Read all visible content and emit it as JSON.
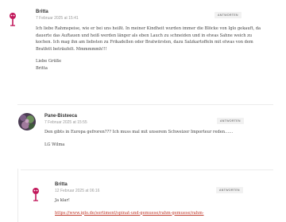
{
  "comments": [
    {
      "author": "Britta",
      "date": "7 Februar 2025 at 15:41",
      "reply": "ANTWORTEN",
      "avatar": "pink-figure-avatar",
      "paragraphs": [
        "Ich liebe Rahmspeise, wie er bei uns heißt. In meiner Kindheit wurden immer die Blöcke von Iglo gekauft, da dauerte das Auftauen und heiß werden länger als eben Lauch zu schneiden und in etwas Sahne weich zu kochen. Ich mag ihn am liebsten zu Frikadellen oder Bratwürsten, dazu Salzkartoffeln mit etwas von dem Bratfett beträufelt. Mmmmmmh!!!",
        "Liebe Grüße",
        "Britta"
      ]
    },
    {
      "author": "Pane-Bisteeca",
      "date": "7 Februar 2025 at 15:55",
      "reply": "ANTWORTEN",
      "avatar": "photo-avatar",
      "paragraphs": [
        "Den gibts in Europa gefroren??? Ich muss mal mit unserem Schweizer Importeur reden……",
        "LG Wilma"
      ]
    },
    {
      "author": "Britta",
      "date": "12 Februar 2025 at 06:16",
      "reply": "ANTWORTEN",
      "avatar": "pink-figure-avatar",
      "paragraphs": [
        "Ja klar!"
      ],
      "link": "https://www.iglo.de/sortiment/spinat-und-gemuese/rahm-gemuese/rahm-"
    }
  ]
}
